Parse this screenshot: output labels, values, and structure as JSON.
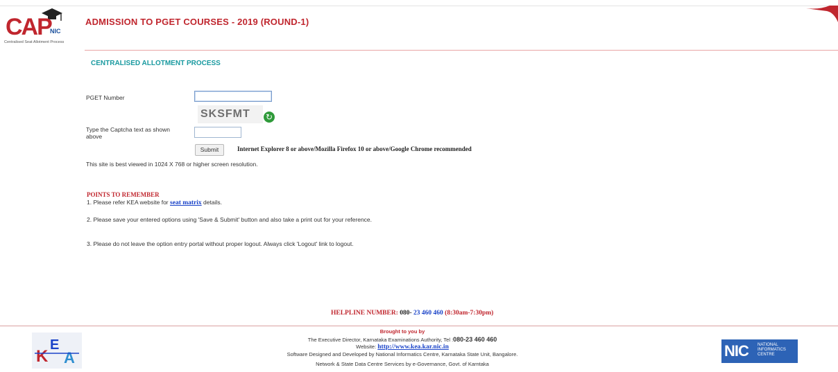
{
  "header": {
    "logo": {
      "text": "CAP",
      "sub_text": "NIC",
      "tagline": "Centralised Seat Allotment Process"
    },
    "title": "ADMISSION TO PGET COURSES - 2019 (ROUND-1)"
  },
  "main": {
    "section_title": "CENTRALISED ALLOTMENT PROCESS",
    "pget_label": "PGET Number",
    "pget_value": "",
    "captcha_image_text": "SKSFMT",
    "captcha_label": "Type the Captcha text as shown above",
    "captcha_value": "",
    "submit_label": "Submit",
    "browser_note": "Internet Explorer 8 or above/Mozilla Firefox 10 or above/Google Chrome recommended",
    "resolution_note": "This site is best viewed in 1024 X 768 or higher screen resolution."
  },
  "points": {
    "heading": "POINTS TO REMEMBER",
    "p1_prefix": "1. Please refer KEA website for",
    "p1_link": "seat matrix",
    "p1_suffix": "details.",
    "p2": "2. Please save your entered options using 'Save & Submit' button and also take a print out for your reference.",
    "p3": "3. Please do not leave the option entry portal without proper logout. Always click 'Logout' link to logout."
  },
  "helpline": {
    "label": "HELPLINE NUMBER:",
    "prefix": "080-",
    "number": "23 460 460",
    "hours": "(8:30am-7:30pm)"
  },
  "footer": {
    "brought": "Brought to you by",
    "line1": "The Executive Director, Karnataka Examinations Authority, Tel :",
    "line1_phone": "080-23 460 460",
    "website_label": "Website:",
    "website_url": "http://www.kea.kar.nic.in",
    "line3": "Software Designed and Developed by National Informatics Centre, Karnataka State Unit, Bangalore.",
    "line4": "Network & State Data Centre Services by e-Governance, Govt. of Karntaka",
    "kea_logo_text": "KEA",
    "nic_logo": {
      "big": "NIC",
      "line1": "NATIONAL",
      "line2": "INFORMATICS",
      "line3": "CENTRE"
    }
  },
  "colors": {
    "brand_red": "#c0262e",
    "teal": "#1a9aa0",
    "link_blue": "#1a43c8",
    "nic_blue": "#2d63b6"
  }
}
